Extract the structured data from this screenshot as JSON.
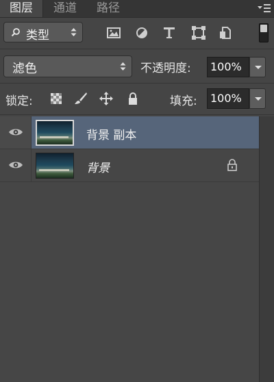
{
  "tabs": {
    "layers": "图层",
    "channels": "通道",
    "paths": "路径"
  },
  "filter": {
    "label": "类型",
    "icons": [
      "pixel-layer-filter-icon",
      "adjustment-layer-filter-icon",
      "type-layer-filter-icon",
      "shape-layer-filter-icon",
      "smart-object-filter-icon"
    ]
  },
  "blend": {
    "mode": "滤色",
    "opacity_label": "不透明度:",
    "opacity_value": "100%"
  },
  "lock": {
    "label": "锁定:",
    "fill_label": "填充:",
    "fill_value": "100%"
  },
  "layers": [
    {
      "name": "背景 副本",
      "selected": true,
      "visible": true,
      "locked": false
    },
    {
      "name": "背景",
      "selected": false,
      "visible": true,
      "locked": true
    }
  ],
  "colors": {
    "panel_bg": "#454545",
    "selected_row": "#56657a",
    "tab_bar": "#353535"
  }
}
